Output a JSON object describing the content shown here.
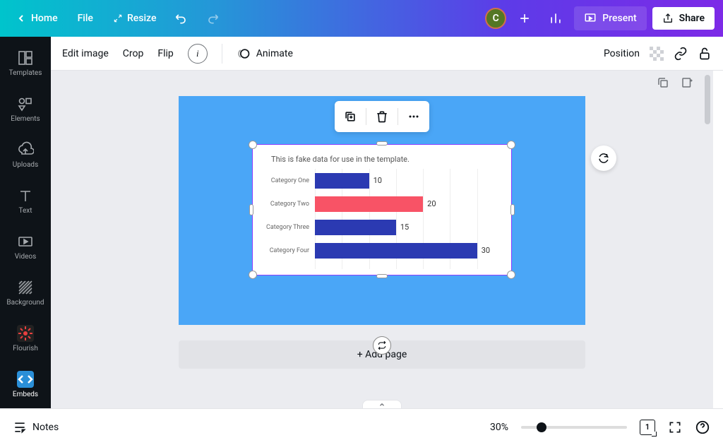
{
  "topbar": {
    "home": "Home",
    "file": "File",
    "resize": "Resize",
    "present": "Present",
    "share": "Share",
    "avatar": "C"
  },
  "sidebar": {
    "items": [
      {
        "label": "Templates"
      },
      {
        "label": "Elements"
      },
      {
        "label": "Uploads"
      },
      {
        "label": "Text"
      },
      {
        "label": "Videos"
      },
      {
        "label": "Background"
      },
      {
        "label": "Flourish"
      },
      {
        "label": "Embeds"
      }
    ]
  },
  "toolbar": {
    "edit_image": "Edit image",
    "crop": "Crop",
    "flip": "Flip",
    "animate": "Animate",
    "position": "Position"
  },
  "chart_data": {
    "type": "bar",
    "orientation": "horizontal",
    "title": "This is fake data for use in the template.",
    "categories": [
      "Category One",
      "Category Two",
      "Category Three",
      "Category Four"
    ],
    "values": [
      10,
      20,
      15,
      30
    ],
    "colors": [
      "#2b3ab2",
      "#f85366",
      "#2b3ab2",
      "#2b3ab2"
    ],
    "xlim": [
      0,
      35
    ]
  },
  "canvas": {
    "add_page": "+ Add page"
  },
  "bottombar": {
    "notes": "Notes",
    "zoom": "30%",
    "page": "1"
  }
}
